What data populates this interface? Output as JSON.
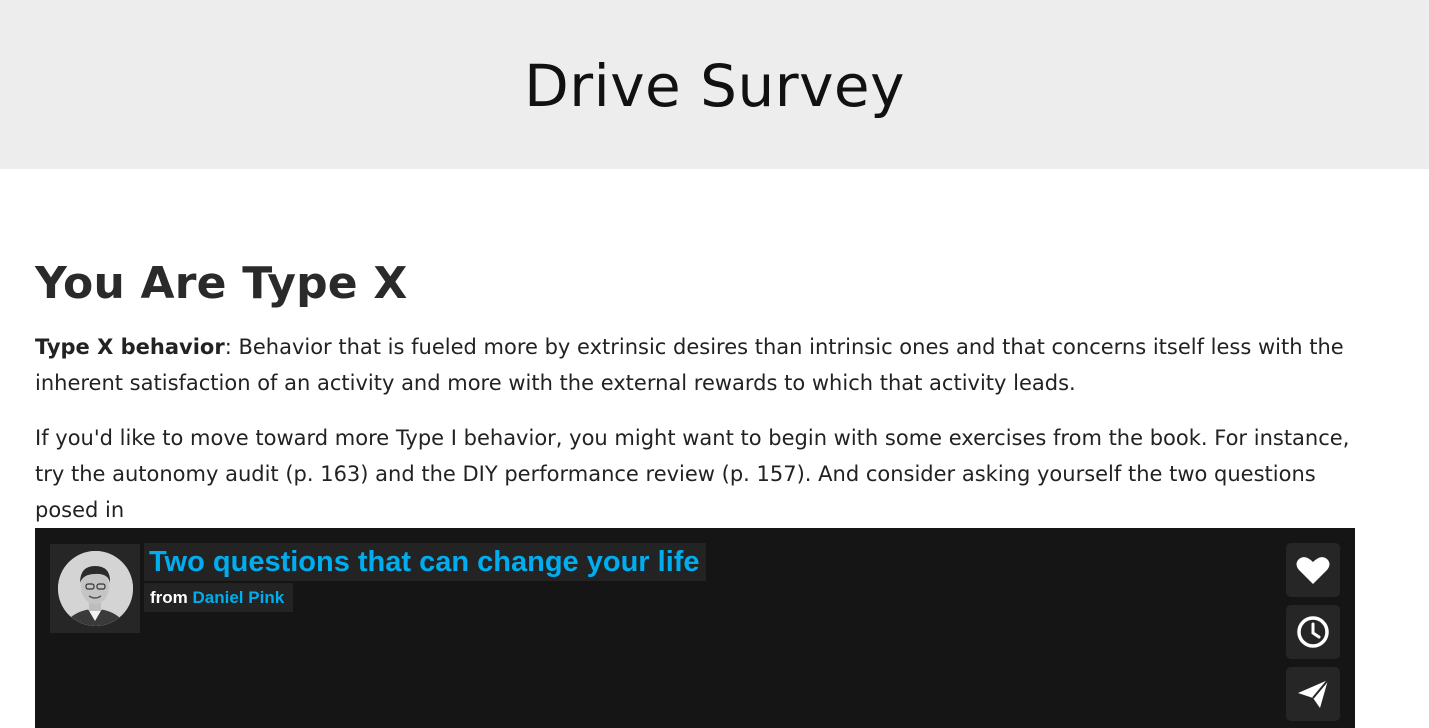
{
  "header": {
    "title": "Drive Survey"
  },
  "result": {
    "heading": "You Are Type X",
    "definition": {
      "term": "Type X behavior",
      "text": ": Behavior that is fueled more by extrinsic desires than intrinsic ones and that concerns itself less with the inherent satisfaction of an activity and more with the external rewards to which that activity leads."
    },
    "advice": "If you'd like to move toward more Type I behavior, you might want to begin with some exercises from the book. For instance, try the autonomy audit (p. 163) and the DIY performance review (p. 157). And consider asking yourself the two questions posed in"
  },
  "video": {
    "title": "Two questions that can change your life",
    "from_label": "from",
    "author": "Daniel Pink",
    "buttons": [
      {
        "name": "like",
        "icon": "heart-icon"
      },
      {
        "name": "watch-later",
        "icon": "clock-icon"
      },
      {
        "name": "share",
        "icon": "paper-plane-icon"
      }
    ],
    "colors": {
      "link": "#00adef",
      "background": "#151515",
      "panel": "#232323"
    }
  }
}
